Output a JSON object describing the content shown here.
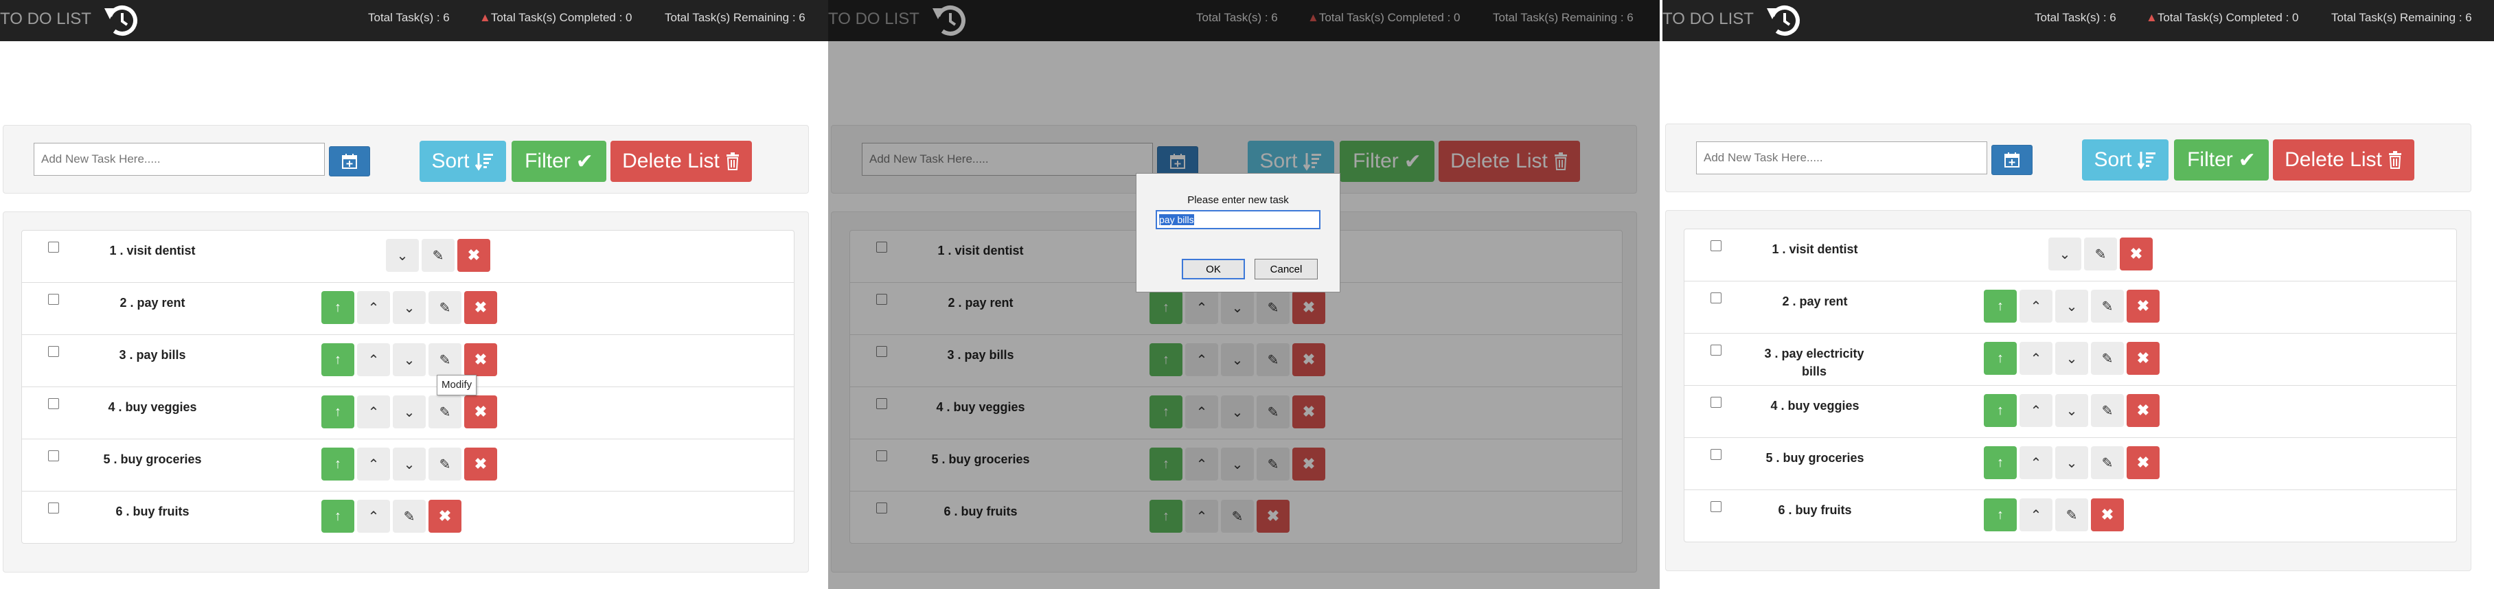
{
  "app_title": "TO DO LIST",
  "stats": {
    "total": "Total Task(s) : 6",
    "completed": "Total Task(s) Completed : 0",
    "remaining": "Total Task(s) Remaining : 6"
  },
  "toolbar": {
    "add_placeholder": "Add New Task Here.....",
    "sort_label": "Sort",
    "filter_label": "Filter",
    "delete_list_label": "Delete List"
  },
  "panel1": {
    "tasks": [
      {
        "name": "1 . visit dentist"
      },
      {
        "name": "2 . pay rent"
      },
      {
        "name": "3 . pay bills"
      },
      {
        "name": "4 . buy veggies"
      },
      {
        "name": "5 . buy groceries"
      },
      {
        "name": "6 . buy fruits"
      }
    ],
    "tooltip": "Modify"
  },
  "panel2": {
    "tasks": [
      {
        "name": "1 . visit dentist"
      },
      {
        "name": "2 . pay rent"
      },
      {
        "name": "3 . pay bills"
      },
      {
        "name": "4 . buy veggies"
      },
      {
        "name": "5 . buy groceries"
      },
      {
        "name": "6 . buy fruits"
      }
    ],
    "dialog": {
      "message": "Please enter new task",
      "value": "pay bills",
      "ok_label": "OK",
      "cancel_label": "Cancel"
    }
  },
  "panel3": {
    "tasks": [
      {
        "name": "1 . visit dentist"
      },
      {
        "name": "2 . pay rent"
      },
      {
        "name": "3 . pay electricity bills"
      },
      {
        "name": "4 . buy veggies"
      },
      {
        "name": "5 . buy groceries"
      },
      {
        "name": "6 . buy fruits"
      }
    ]
  },
  "colors": {
    "navbar": "#222222",
    "info": "#5bc0de",
    "success": "#5cb85c",
    "danger": "#d9534f",
    "primary": "#337ab7"
  }
}
